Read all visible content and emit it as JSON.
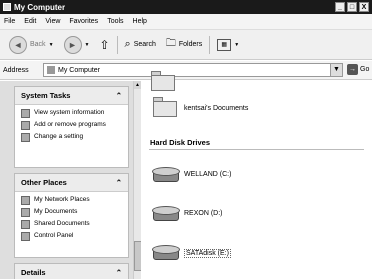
{
  "window": {
    "title": "My Computer",
    "min": "_",
    "max": "□",
    "close": "X"
  },
  "menu": [
    "File",
    "Edit",
    "View",
    "Favorites",
    "Tools",
    "Help"
  ],
  "toolbar": {
    "back": "Back",
    "search": "Search",
    "folders": "Folders"
  },
  "address": {
    "label": "Address",
    "value": "My Computer",
    "go": "Go"
  },
  "tasks": {
    "system": {
      "title": "System Tasks",
      "items": [
        "View system information",
        "Add or remove programs",
        "Change a setting"
      ]
    },
    "other": {
      "title": "Other Places",
      "items": [
        "My Network Places",
        "My Documents",
        "Shared Documents",
        "Control Panel"
      ]
    },
    "details": {
      "title": "Details"
    }
  },
  "content": {
    "folder": "kentsai's Documents",
    "section": "Hard Disk Drives",
    "drives": [
      "WELLAND (C:)",
      "REXON (D:)",
      "SATAdisk (E:)"
    ]
  }
}
